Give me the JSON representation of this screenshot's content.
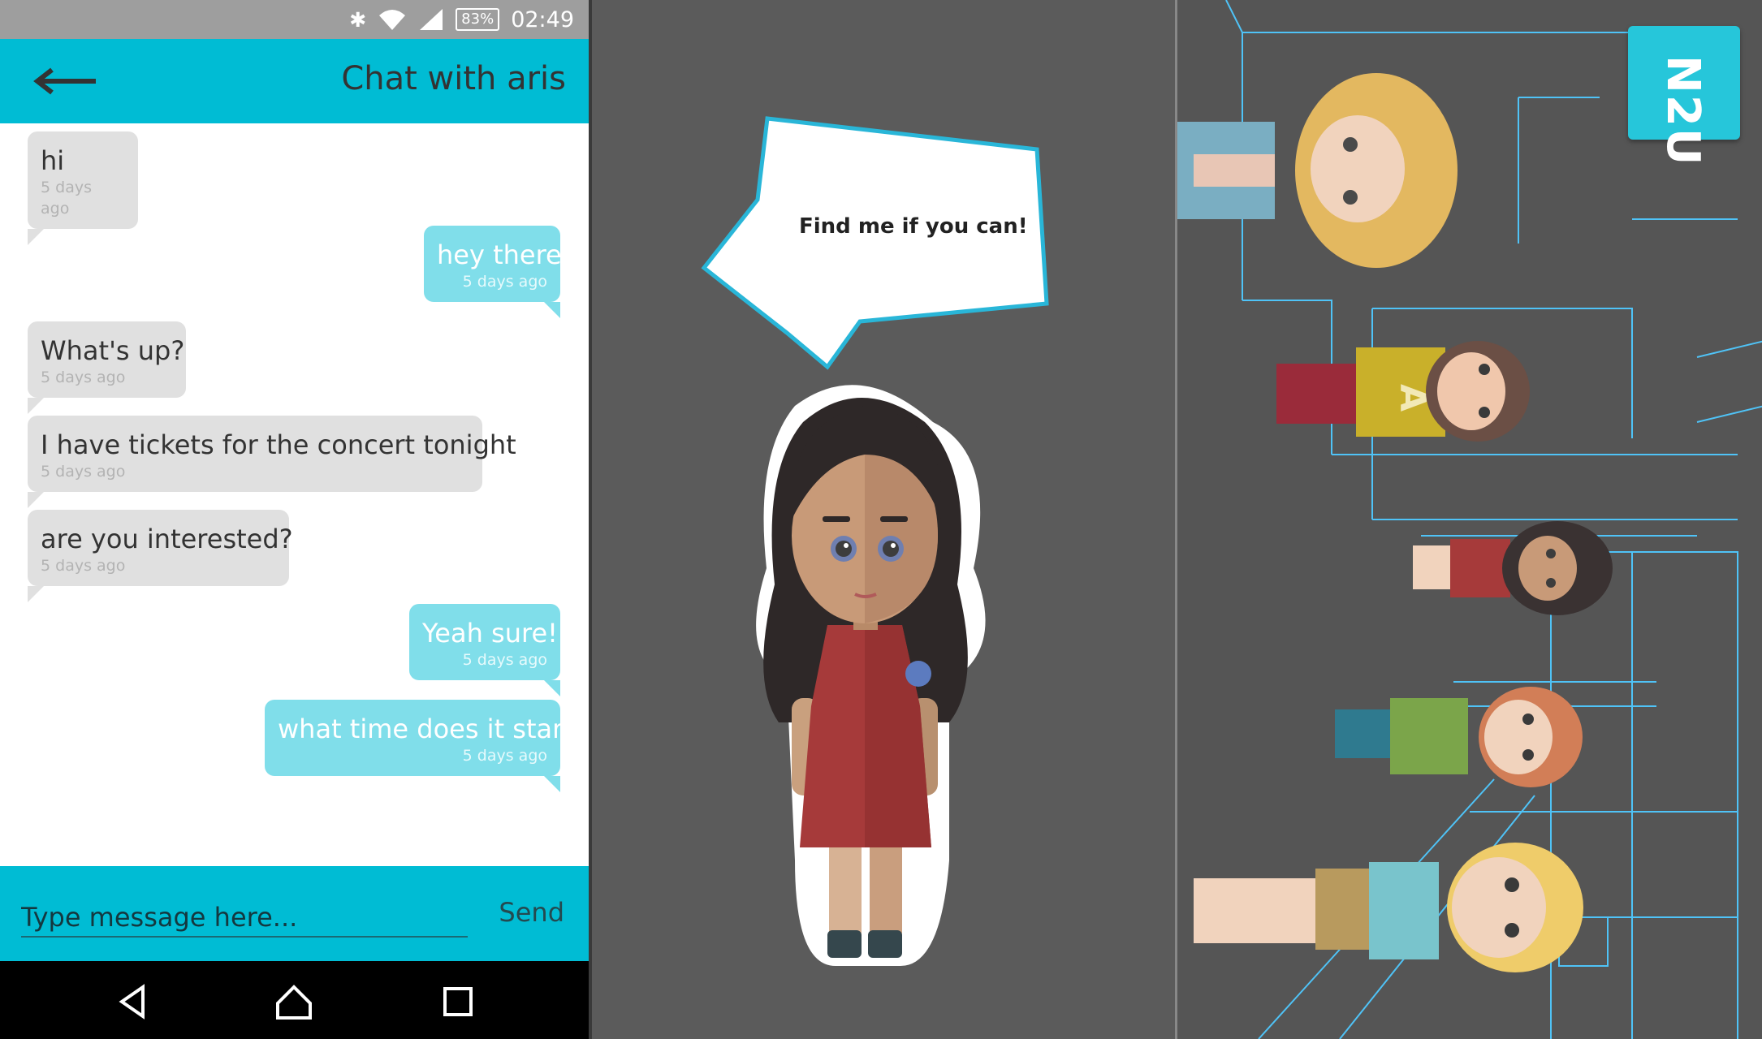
{
  "status_bar": {
    "icons": [
      "bluetooth-icon",
      "wifi-icon",
      "signal-icon"
    ],
    "battery": "83%",
    "time": "02:49"
  },
  "chat": {
    "title": "Chat with aris",
    "messages": [
      {
        "direction": "in",
        "text": "hi",
        "time": "5 days ago"
      },
      {
        "direction": "out",
        "text": "hey there",
        "time": "5 days ago"
      },
      {
        "direction": "in",
        "text": "What's up?",
        "time": "5 days ago"
      },
      {
        "direction": "in",
        "text": "I have tickets for the concert tonight",
        "time": "5 days ago"
      },
      {
        "direction": "in",
        "text": "are you interested?",
        "time": "5 days ago"
      },
      {
        "direction": "out",
        "text": "Yeah sure!",
        "time": "5 days ago"
      },
      {
        "direction": "out",
        "text": "what time does it start?",
        "time": "5 days ago"
      }
    ],
    "input_placeholder": "Type message here...",
    "send_label": "Send"
  },
  "nav": {
    "icons": [
      "back-triangle-icon",
      "home-icon",
      "recents-square-icon"
    ]
  },
  "avatar_scene": {
    "speech": "Find me if you can!"
  },
  "lineup_scene": {
    "logo_text": "N2U",
    "shirt_letter": "A"
  },
  "colors": {
    "accent": "#00bcd4",
    "incoming_bubble": "#e0e0e0",
    "outgoing_bubble": "#80deea",
    "scene_background": "#5b5b5b",
    "grid_lines": "#4fc3f7"
  }
}
